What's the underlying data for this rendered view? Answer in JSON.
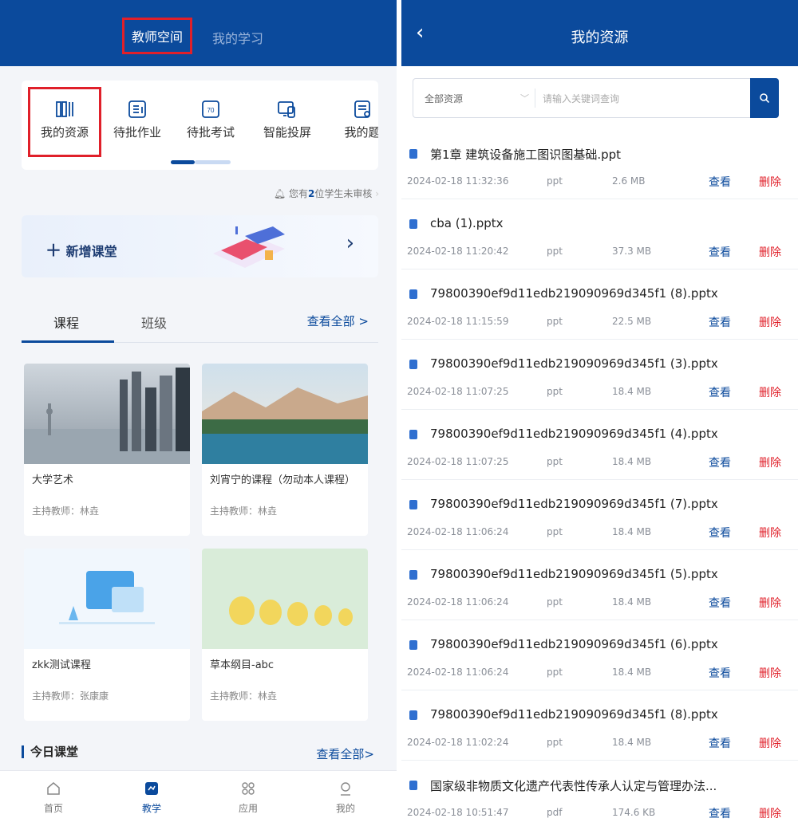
{
  "left": {
    "tabs": [
      "教师空间",
      "我的学习"
    ],
    "quick": [
      "我的资源",
      "待批作业",
      "待批考试",
      "智能投屏",
      "我的题"
    ],
    "notice_pre": "您有",
    "notice_num": "2",
    "notice_post": "位学生未审核",
    "new_class": "新增课堂",
    "course_tabs": [
      "课程",
      "班级"
    ],
    "see_all": "查看全部 >",
    "courses": [
      {
        "title": "大学艺术",
        "teacher": "主持教师：林垚"
      },
      {
        "title": "刘宵宁的课程（勿动本人课程）",
        "teacher": "主持教师：林垚"
      },
      {
        "title": "zkk测试课程",
        "teacher": "主持教师：张康康"
      },
      {
        "title": "草本纲目-abc",
        "teacher": "主持教师：林垚"
      }
    ],
    "today": "今日课堂",
    "today_all": "查看全部>",
    "nav": [
      "首页",
      "教学",
      "应用",
      "我的"
    ]
  },
  "right": {
    "title": "我的资源",
    "filter": "全部资源",
    "placeholder": "请输入关键词查询",
    "view_label": "查看",
    "delete_label": "删除",
    "files": [
      {
        "name": "第1章 建筑设备施工图识图基础.ppt",
        "date": "2024-02-18 11:32:36",
        "type": "ppt",
        "size": "2.6 MB"
      },
      {
        "name": "cba (1).pptx",
        "date": "2024-02-18 11:20:42",
        "type": "ppt",
        "size": "37.3 MB"
      },
      {
        "name": "79800390ef9d11edb219090969d345f1 (8).pptx",
        "date": "2024-02-18 11:15:59",
        "type": "ppt",
        "size": "22.5 MB"
      },
      {
        "name": "79800390ef9d11edb219090969d345f1 (3).pptx",
        "date": "2024-02-18 11:07:25",
        "type": "ppt",
        "size": "18.4 MB"
      },
      {
        "name": "79800390ef9d11edb219090969d345f1 (4).pptx",
        "date": "2024-02-18 11:07:25",
        "type": "ppt",
        "size": "18.4 MB"
      },
      {
        "name": "79800390ef9d11edb219090969d345f1 (7).pptx",
        "date": "2024-02-18 11:06:24",
        "type": "ppt",
        "size": "18.4 MB"
      },
      {
        "name": "79800390ef9d11edb219090969d345f1 (5).pptx",
        "date": "2024-02-18 11:06:24",
        "type": "ppt",
        "size": "18.4 MB"
      },
      {
        "name": "79800390ef9d11edb219090969d345f1 (6).pptx",
        "date": "2024-02-18 11:06:24",
        "type": "ppt",
        "size": "18.4 MB"
      },
      {
        "name": "79800390ef9d11edb219090969d345f1 (8).pptx",
        "date": "2024-02-18 11:02:24",
        "type": "ppt",
        "size": "18.4 MB"
      },
      {
        "name": "国家级非物质文化遗产代表性传承人认定与管理办法...",
        "date": "2024-02-18 10:51:47",
        "type": "pdf",
        "size": "174.6 KB"
      }
    ]
  },
  "colors": {
    "primary": "#0b4a9c",
    "highlight": "#e0202a",
    "delete": "#e0202a"
  }
}
